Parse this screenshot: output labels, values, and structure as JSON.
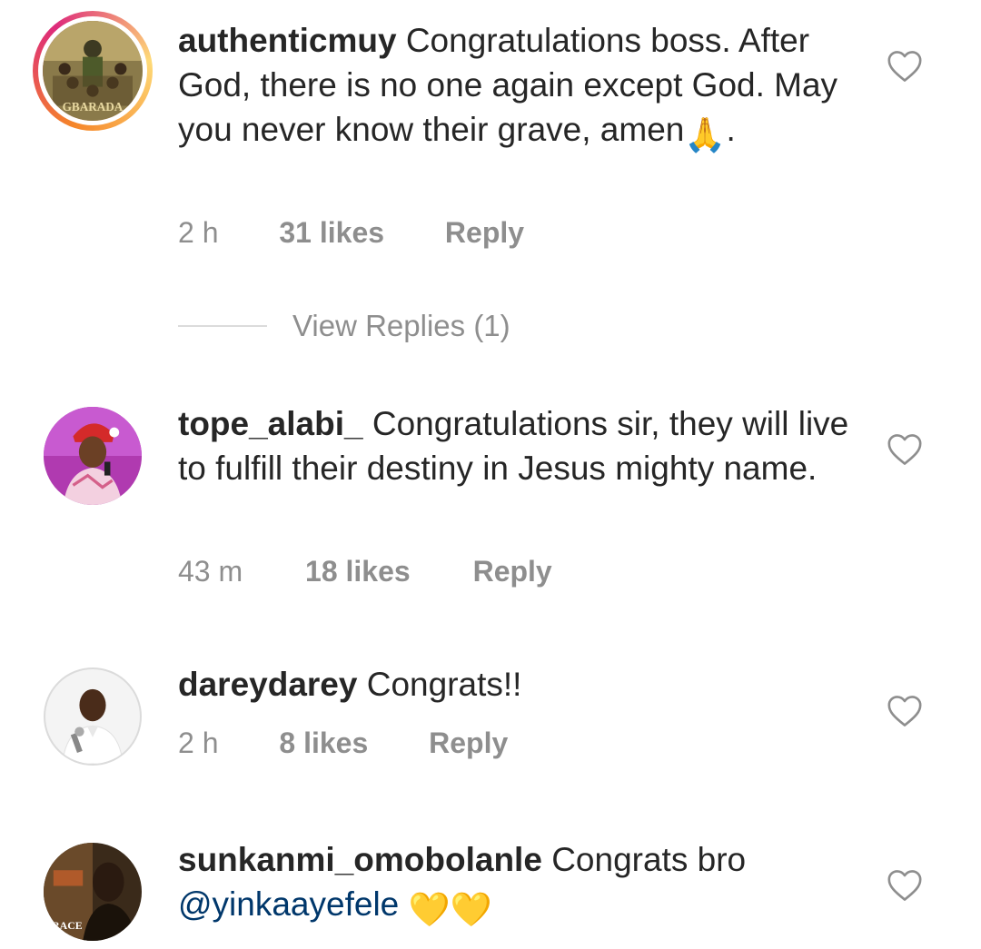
{
  "comments": [
    {
      "username": "authenticmuy",
      "text": "Congratulations boss. After God, there is no one again except God. May you never know their grave, amen",
      "emoji": "🙏",
      "suffix": ".",
      "time": "2 h",
      "likes": "31 likes",
      "reply": "Reply",
      "avatar_text": "GBARADA"
    },
    {
      "username": "tope_alabi_",
      "text": "Congratulations sir, they will live to fulfill their destiny in Jesus mighty name.",
      "time": "43 m",
      "likes": "18 likes",
      "reply": "Reply"
    },
    {
      "username": "dareydarey",
      "text": "Congrats!!",
      "time": "2 h",
      "likes": "8 likes",
      "reply": "Reply"
    },
    {
      "username": "sunkanmi_omobolanle",
      "text": "Congrats bro",
      "mention": "@yinkaayefele",
      "emoji": "💛💛",
      "avatar_text": "RACE"
    }
  ],
  "view_replies": "View Replies (1)",
  "colors": {
    "text": "#262626",
    "muted": "#8e8e8e",
    "mention": "#00376b",
    "divider": "#dbdbdb"
  },
  "icons": {
    "like": "heart-outline-icon"
  }
}
